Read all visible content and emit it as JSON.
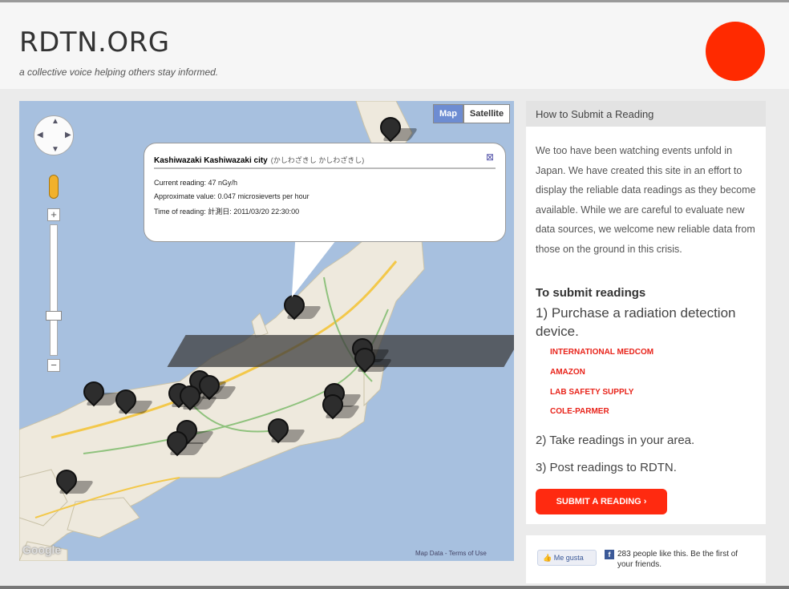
{
  "site": {
    "logo": "RDTN.ORG",
    "tagline": "a collective voice helping others stay informed.",
    "accent_color": "#ff2a00"
  },
  "map": {
    "type_buttons": {
      "map": "Map",
      "satellite": "Satellite"
    },
    "pan_icon": "pan-control-icon",
    "google_mark": "Google",
    "terms": "Map Data - Terms of Use",
    "popup": {
      "title": "Kashiwazaki Kashiwazaki city",
      "title_jp": "(かしわざきし かしわざきし)",
      "close_icon": "close-icon",
      "current_reading": "Current reading: 47 nGy/h",
      "approximate_value": "Approximate value: 0.047 microsieverts per hour",
      "time_of_reading": "Time of reading: 計測日: 2011/03/20 22:30:00"
    },
    "marker_icon": "map-marker-icon"
  },
  "sidebar": {
    "heading": "How to Submit a Reading",
    "intro": "We too have been watching events unfold in Japan. We have created this site in an effort to display the reliable data readings as they become available. While we are careful to evaluate new data sources, we welcome new reliable data from those on the ground in this crisis.",
    "subheading": "To submit readings",
    "step1": "1) Purchase a radiation detection device.",
    "vendors": [
      "INTERNATIONAL MEDCOM",
      "AMAZON",
      "LAB SAFETY SUPPLY",
      "COLE-PARMER"
    ],
    "step2": "2) Take readings in your area.",
    "step3": "3) Post readings to RDTN.",
    "submit_label": "SUBMIT A READING ›"
  },
  "facebook": {
    "like_label": "Me gusta",
    "like_text": "283 people like this. Be the first of your friends."
  }
}
